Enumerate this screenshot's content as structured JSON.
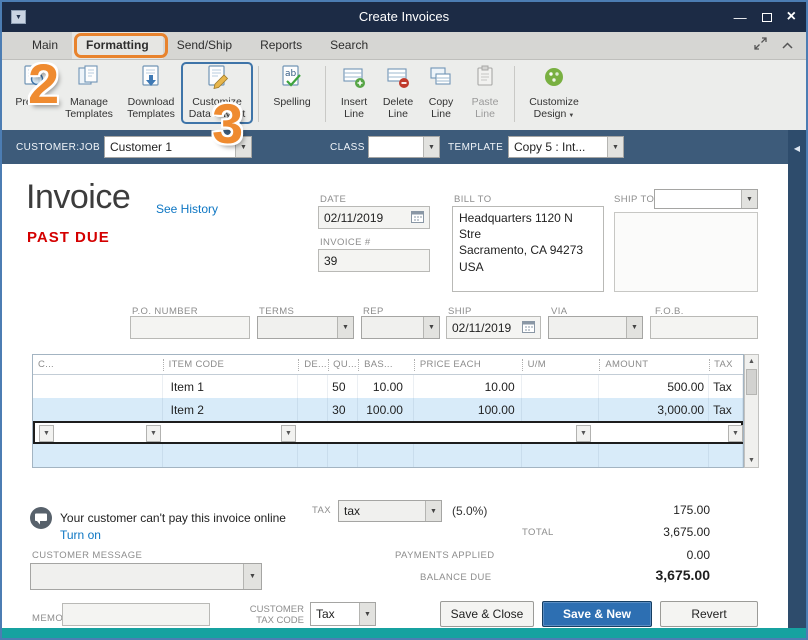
{
  "glyphs": {
    "caret_down": "▼",
    "chevron_left": "◀",
    "window_menu": "▼",
    "minimize": "—",
    "close": "×",
    "up_arrow": "▲",
    "down_arrow": "▼"
  },
  "window": {
    "title": "Create Invoices"
  },
  "tabs": {
    "items": [
      {
        "label": "Main"
      },
      {
        "label": "Formatting"
      },
      {
        "label": "Send/Ship"
      },
      {
        "label": "Reports"
      },
      {
        "label": "Search"
      }
    ]
  },
  "toolbar": {
    "preview": "Preview",
    "manage_templates": "Manage Templates",
    "download_templates": "Download Templates",
    "customize_data_layout": "Customize Data Layout",
    "spelling": "Spelling",
    "insert_line": "Insert Line",
    "delete_line": "Delete Line",
    "copy_line": "Copy Line",
    "paste_line": "Paste Line",
    "customize_design": "Customize Design"
  },
  "annotations": {
    "step_2": "2",
    "step_3": "3"
  },
  "customer_bar": {
    "customer_job_label": "CUSTOMER:JOB",
    "customer_job_value": "Customer 1",
    "class_label": "CLASS",
    "template_label": "TEMPLATE",
    "template_value": "Copy 5 : Int..."
  },
  "invoice_header": {
    "title": "Invoice",
    "see_history": "See History",
    "status": "PAST DUE",
    "date_label": "DATE",
    "date_value": "02/11/2019",
    "invoice_number_label": "INVOICE #",
    "invoice_number_value": "39",
    "bill_to_label": "BILL TO",
    "bill_to_line1": "Headquarters 1120 N Stre",
    "bill_to_line2": "Sacramento, CA 94273",
    "bill_to_line3": "USA",
    "ship_to_label": "SHIP TO"
  },
  "detail_fields": {
    "po_number_label": "P.O. NUMBER",
    "terms_label": "TERMS",
    "rep_label": "REP",
    "ship_label": "SHIP",
    "ship_value": "02/11/2019",
    "via_label": "VIA",
    "fob_label": "F.O.B."
  },
  "items_table": {
    "headers": [
      "C...",
      "ITEM CODE",
      "DE...",
      "QU...",
      "BAS...",
      "PRICE EACH",
      "U/M",
      "AMOUNT",
      "TAX"
    ],
    "rows": [
      {
        "item_code": "Item 1",
        "qty": "50",
        "base": "10.00",
        "price_each": "10.00",
        "amount": "500.00",
        "tax": "Tax"
      },
      {
        "item_code": "Item 2",
        "qty": "30",
        "base": "100.00",
        "price_each": "100.00",
        "amount": "3,000.00",
        "tax": "Tax"
      }
    ]
  },
  "footer": {
    "online_payment_message": "Your customer can't pay this invoice online",
    "turn_on_link": "Turn on",
    "customer_message_label": "CUSTOMER MESSAGE",
    "memo_label": "MEMO",
    "customer_tax_code_label_line1": "CUSTOMER",
    "customer_tax_code_label_line2": "TAX CODE",
    "customer_tax_code_value": "Tax",
    "tax_label": "TAX",
    "tax_value": "tax",
    "tax_rate": "(5.0%)",
    "tax_amount": "175.00",
    "total_label": "TOTAL",
    "total_value": "3,675.00",
    "payments_applied_label": "PAYMENTS APPLIED",
    "payments_applied_value": "0.00",
    "balance_due_label": "BALANCE DUE",
    "balance_due_value": "3,675.00"
  },
  "buttons": {
    "save_and_close": "Save & Close",
    "save_and_new": "Save & New",
    "revert": "Revert"
  },
  "colors": {
    "titlebar": "#1c2b45",
    "customer_bar": "#3d5b7a",
    "annotation_orange": "#ef8b30",
    "highlight_blue": "#3e74a8",
    "past_due_red": "#d40000",
    "link_blue": "#0d76c3",
    "primary_button_blue": "#2d6fb2",
    "row_alt_blue": "#d8ebf9",
    "bottom_bar_teal": "#16a2a0"
  }
}
